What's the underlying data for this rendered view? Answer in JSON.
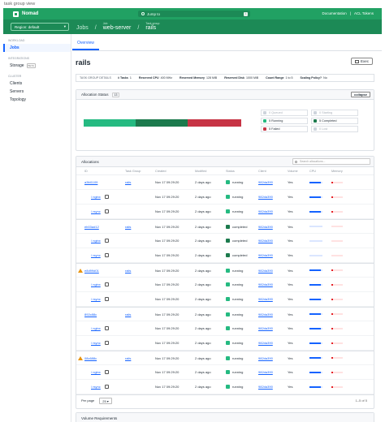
{
  "window_caption": "task group view",
  "brand": {
    "name": "Nomad"
  },
  "search": {
    "placeholder": "Jump to",
    "shortcut": "/"
  },
  "top_links": [
    "Documentation",
    "|",
    "ACL Tokens"
  ],
  "region": {
    "label": "Region: default"
  },
  "breadcrumbs": [
    {
      "label": "Job",
      "value": "web-server"
    },
    {
      "label": "Task group",
      "value": "rails"
    }
  ],
  "sidebar": {
    "sections": [
      {
        "heading": "Workload",
        "items": [
          {
            "label": "Jobs",
            "active": true
          }
        ]
      },
      {
        "heading": "Integrations",
        "items": [
          {
            "label": "Storage",
            "badge": "BETA"
          }
        ]
      },
      {
        "heading": "Cluster",
        "items": [
          {
            "label": "Clients"
          },
          {
            "label": "Servers"
          },
          {
            "label": "Topology"
          }
        ]
      }
    ]
  },
  "tabs": [
    "Overview"
  ],
  "page_title": "rails",
  "exec_button": "Exec",
  "stats": {
    "heading": "TASK GROUP DETAILS",
    "items": [
      {
        "label": "# Tasks",
        "value": "1"
      },
      {
        "label": "Reserved CPU",
        "value": "400 MHz"
      },
      {
        "label": "Reserved Memory",
        "value": "128 MiB"
      },
      {
        "label": "Reserved Disk",
        "value": "1000 MiB"
      },
      {
        "label": "Count Range",
        "value": "1 to 5"
      },
      {
        "label": "Scaling Policy?",
        "value": "No"
      }
    ]
  },
  "allocation_status": {
    "title": "Allocation Status",
    "count": "13",
    "collapse_label": "collapse",
    "bar_fractions": [
      0.33,
      0.33,
      0.34
    ],
    "legend": [
      {
        "label": "0 Queued",
        "color": "#cdd4dc",
        "dim": true
      },
      {
        "label": "0 Starting",
        "color": "#cdd4dc",
        "dim": true
      },
      {
        "label": "5 Running",
        "color": "#25ba81",
        "dim": false
      },
      {
        "label": "5 Completed",
        "color": "#1c7a4d",
        "dim": false
      },
      {
        "label": "5 Failed",
        "color": "#c73445",
        "dim": false
      },
      {
        "label": "0 Lost",
        "color": "#cdd4dc",
        "dim": true
      }
    ]
  },
  "allocations": {
    "title": "Allocations",
    "search_placeholder": "Search allocations...",
    "columns": [
      "ID",
      "Task Group",
      "Created",
      "Modified",
      "Status",
      "Client",
      "Volume",
      "CPU",
      "Memory"
    ],
    "rows": [
      {
        "kind": "alloc",
        "warn": false,
        "id": "a3fd1109",
        "group": "rails",
        "created": "Nov 17 09:29:20",
        "modified": "2 days ago",
        "status": "running",
        "status_color": "#25ba81",
        "client": "982da390",
        "volume": "Yes",
        "cpu": 0.85,
        "mem": 0.12
      },
      {
        "kind": "task",
        "id": "/ nginx",
        "created": "Nov 17 09:29:20",
        "modified": "2 days ago",
        "status": "running",
        "status_color": "#25ba81",
        "client": "982da390",
        "volume": "Yes",
        "cpu": 0.85,
        "mem": 0.12
      },
      {
        "kind": "task",
        "id": "/ rsync",
        "created": "Nov 17 09:29:20",
        "modified": "2 days ago",
        "status": "running",
        "status_color": "#25ba81",
        "client": "982da390",
        "volume": "Yes",
        "cpu": 0.85,
        "mem": 0.12
      },
      {
        "kind": "alloc",
        "warn": false,
        "id": "eb03ad12",
        "group": "rails",
        "created": "Nov 17 09:29:20",
        "modified": "2 days ago",
        "status": "completed",
        "status_color": "#1c7a4d",
        "client": "982da390",
        "volume": "Yes",
        "cpu": 0,
        "mem": 0
      },
      {
        "kind": "task",
        "id": "/ nginx",
        "created": "Nov 17 09:29:20",
        "modified": "2 days ago",
        "status": "completed",
        "status_color": "#1c7a4d",
        "client": "982da390",
        "volume": "Yes",
        "cpu": 0,
        "mem": 0
      },
      {
        "kind": "task",
        "id": "/ rsync",
        "created": "Nov 17 09:29:20",
        "modified": "2 days ago",
        "status": "completed",
        "status_color": "#1c7a4d",
        "client": "982da390",
        "volume": "Yes",
        "cpu": 0,
        "mem": 0
      },
      {
        "kind": "alloc",
        "warn": true,
        "id": "e8d99d01",
        "group": "rails",
        "created": "Nov 17 09:29:20",
        "modified": "2 days ago",
        "status": "running",
        "status_color": "#25ba81",
        "client": "982da390",
        "volume": "Yes",
        "cpu": 0.85,
        "mem": 0.12
      },
      {
        "kind": "task",
        "id": "/ nginx",
        "created": "Nov 17 09:29:20",
        "modified": "2 days ago",
        "status": "running",
        "status_color": "#25ba81",
        "client": "982da390",
        "volume": "Yes",
        "cpu": 0.85,
        "mem": 0.12
      },
      {
        "kind": "task",
        "id": "/ rsync",
        "created": "Nov 17 09:29:20",
        "modified": "2 days ago",
        "status": "running",
        "status_color": "#25ba81",
        "client": "982da390",
        "volume": "Yes",
        "cpu": 0.85,
        "mem": 0.12
      },
      {
        "kind": "alloc",
        "warn": false,
        "id": "892c88c",
        "group": "rails",
        "created": "Nov 17 09:29:20",
        "modified": "2 days ago",
        "status": "running",
        "status_color": "#25ba81",
        "client": "982da390",
        "volume": "Yes",
        "cpu": 0.85,
        "mem": 0.12
      },
      {
        "kind": "task",
        "id": "/ nginx",
        "created": "Nov 17 09:29:20",
        "modified": "2 days ago",
        "status": "running",
        "status_color": "#25ba81",
        "client": "982da390",
        "volume": "Yes",
        "cpu": 0.85,
        "mem": 0.12
      },
      {
        "kind": "task",
        "id": "/ rsync",
        "created": "Nov 17 09:29:20",
        "modified": "2 days ago",
        "status": "running",
        "status_color": "#25ba81",
        "client": "982da390",
        "volume": "Yes",
        "cpu": 0.85,
        "mem": 0.12
      },
      {
        "kind": "alloc",
        "warn": true,
        "id": "08c688c",
        "group": "rails",
        "created": "Nov 17 09:29:20",
        "modified": "2 days ago",
        "status": "running",
        "status_color": "#25ba81",
        "client": "982da390",
        "volume": "Yes",
        "cpu": 0.85,
        "mem": 0.12
      },
      {
        "kind": "task",
        "id": "/ nginx",
        "created": "Nov 17 09:29:20",
        "modified": "2 days ago",
        "status": "running",
        "status_color": "#25ba81",
        "client": "982da390",
        "volume": "Yes",
        "cpu": 0.85,
        "mem": 0.12
      },
      {
        "kind": "task",
        "id": "/ rsync",
        "created": "Nov 17 09:29:20",
        "modified": "2 days ago",
        "status": "running",
        "status_color": "#25ba81",
        "client": "982da390",
        "volume": "Yes",
        "cpu": 0.85,
        "mem": 0.12
      }
    ],
    "pager": {
      "per_page_label": "Per page",
      "per_page_value": "25",
      "range": "1–5 of 5"
    }
  },
  "volume_requirements": {
    "title": "Volume Requirements"
  },
  "colors": {
    "brand_green": "#21a163",
    "subbar_green": "#1c8a56",
    "link_blue": "#1563ff",
    "running": "#25ba81",
    "completed": "#1c7a4d",
    "failed": "#c73445"
  }
}
